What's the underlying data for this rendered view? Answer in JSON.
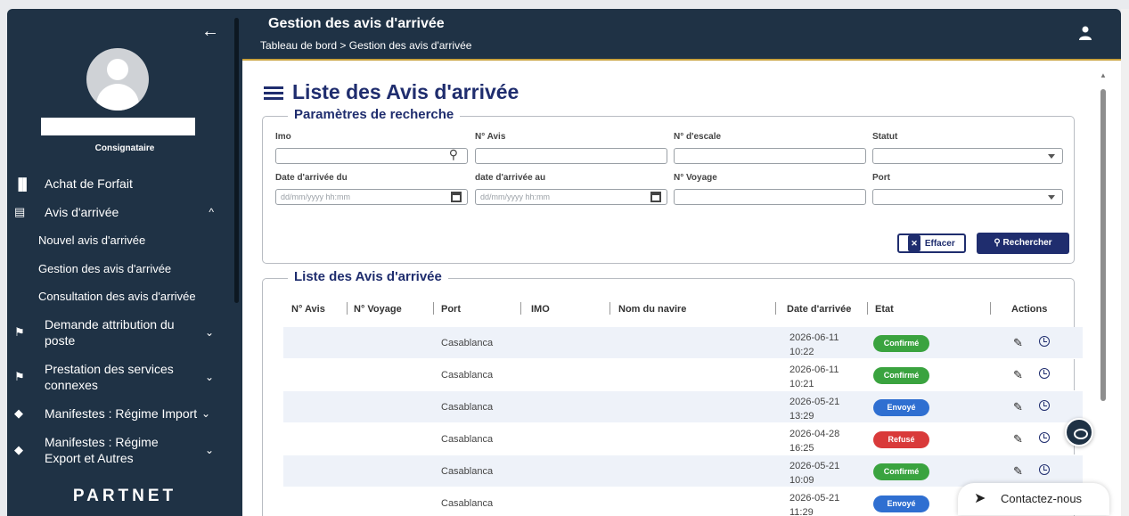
{
  "sidebar": {
    "role": "Consignataire",
    "logo": "PARTNET",
    "items": [
      {
        "icon": "bar-chart-icon",
        "label": "Achat de Forfait"
      },
      {
        "icon": "calendar-icon",
        "label": "Avis d'arrivée",
        "expanded": true,
        "children": [
          "Nouvel avis d'arrivée",
          "Gestion des avis d'arrivée",
          "Consultation des avis d'arrivée"
        ]
      },
      {
        "icon": "flag-icon",
        "label": "Demande attribution du poste"
      },
      {
        "icon": "flag-icon",
        "label": "Prestation des services connexes"
      },
      {
        "icon": "layers-icon",
        "label": "Manifestes : Régime Import"
      },
      {
        "icon": "layers-icon",
        "label": "Manifestes : Régime Export et Autres"
      }
    ]
  },
  "header": {
    "title": "Gestion des avis d'arrivée",
    "breadcrumb": "Tableau de bord > Gestion des avis d'arrivée"
  },
  "page": {
    "title": "Liste des Avis d'arrivée"
  },
  "search": {
    "legend": "Paramètres de recherche",
    "imo_label": "Imo",
    "num_avis_label": "N° Avis",
    "escale_label": "N° d'escale",
    "statut_label": "Statut",
    "date_du_label": "Date d'arrivée du",
    "date_au_label": "date d'arrivée au",
    "voyage_label": "N° Voyage",
    "port_label": "Port",
    "date_placeholder": "dd/mm/yyyy hh:mm",
    "clear_label": "Effacer",
    "search_label": "Rechercher"
  },
  "list": {
    "legend": "Liste des Avis d'arrivée",
    "columns": [
      "N° Avis",
      "N° Voyage",
      "Port",
      "IMO",
      "Nom du navire",
      "Date d'arrivée",
      "Etat",
      "Actions"
    ],
    "rows": [
      {
        "port": "Casablanca",
        "date": "2026-06-11",
        "time": "10:22",
        "etat": "Confirmé"
      },
      {
        "port": "Casablanca",
        "date": "2026-06-11",
        "time": "10:21",
        "etat": "Confirmé"
      },
      {
        "port": "Casablanca",
        "date": "2026-05-21",
        "time": "13:29",
        "etat": "Envoyé"
      },
      {
        "port": "Casablanca",
        "date": "2026-04-28",
        "time": "16:25",
        "etat": "Refusé"
      },
      {
        "port": "Casablanca",
        "date": "2026-05-21",
        "time": "10:09",
        "etat": "Confirmé"
      },
      {
        "port": "Casablanca",
        "date": "2026-05-21",
        "time": "11:29",
        "etat": "Envoyé"
      }
    ]
  },
  "status_colors": {
    "Confirmé": "#3aa33f",
    "Envoyé": "#2f6fd1",
    "Refusé": "#d93a3a"
  },
  "contact_label": "Contactez-nous"
}
